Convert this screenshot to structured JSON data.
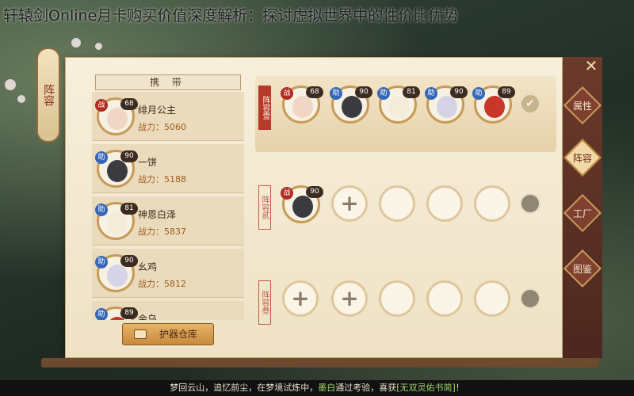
{
  "title_overlay": "轩辕剑Online月卡购买价值深度解析：探讨虚拟世界中的性价比优势",
  "lantern_label": "阵容",
  "close_label": "✕",
  "side_tabs": [
    {
      "label": "属性",
      "active": false
    },
    {
      "label": "阵容",
      "active": true
    },
    {
      "label": "工厂",
      "active": false
    },
    {
      "label": "图鉴",
      "active": false
    }
  ],
  "carry": {
    "header": "携 带",
    "heroes": [
      {
        "name": "绯月公主",
        "power_label": "战力：",
        "power": "5060",
        "role": "战",
        "level": "68",
        "face_color": "#f1d6c6"
      },
      {
        "name": "一饼",
        "power_label": "战力：",
        "power": "5188",
        "role": "助",
        "level": "90",
        "face_color": "#3b3b3f"
      },
      {
        "name": "神恩白泽",
        "power_label": "战力：",
        "power": "5837",
        "role": "助",
        "level": "81",
        "face_color": "#f4ecd9"
      },
      {
        "name": "幺鸡",
        "power_label": "战力：",
        "power": "5812",
        "role": "助",
        "level": "90",
        "face_color": "#d7d3e6"
      },
      {
        "name": "金乌",
        "power_label": "",
        "power": "",
        "role": "助",
        "level": "89",
        "face_color": "#c9362a"
      }
    ],
    "storage_button": "护器仓库"
  },
  "lineups": [
    {
      "label": "阵容壹",
      "slots": [
        {
          "type": "hero",
          "role": "战",
          "level": "68",
          "face_color": "#f1d6c6"
        },
        {
          "type": "hero",
          "role": "助",
          "level": "90",
          "face_color": "#3b3b3f"
        },
        {
          "type": "hero",
          "role": "助",
          "level": "81",
          "face_color": "#f4ecd9"
        },
        {
          "type": "hero",
          "role": "助",
          "level": "90",
          "face_color": "#d7d3e6"
        },
        {
          "type": "hero",
          "role": "助",
          "level": "89",
          "face_color": "#c9362a"
        }
      ],
      "confirm": "✔"
    },
    {
      "label": "阵容贰",
      "slots": [
        {
          "type": "hero",
          "role": "战",
          "level": "90",
          "face_color": "#3b3b3f"
        },
        {
          "type": "add",
          "symbol": "+"
        },
        {
          "type": "empty"
        },
        {
          "type": "empty"
        },
        {
          "type": "empty"
        }
      ],
      "confirm": ""
    },
    {
      "label": "阵容叁",
      "slots": [
        {
          "type": "add",
          "symbol": "+"
        },
        {
          "type": "add",
          "symbol": "+"
        },
        {
          "type": "empty"
        },
        {
          "type": "empty"
        },
        {
          "type": "empty"
        }
      ],
      "confirm": ""
    }
  ],
  "bottom_message": {
    "pre": "梦回云山，追忆前尘，在梦境试炼中，",
    "player": "墨白",
    "mid": "通过考验，喜获",
    "item": "[无双灵佑书简]",
    "post": "！"
  },
  "colors": {
    "role_zhan": "#b2291f",
    "role_zhu": "#3467b7",
    "power_text": "#a05a1a",
    "highlight": "#9fd26a"
  }
}
